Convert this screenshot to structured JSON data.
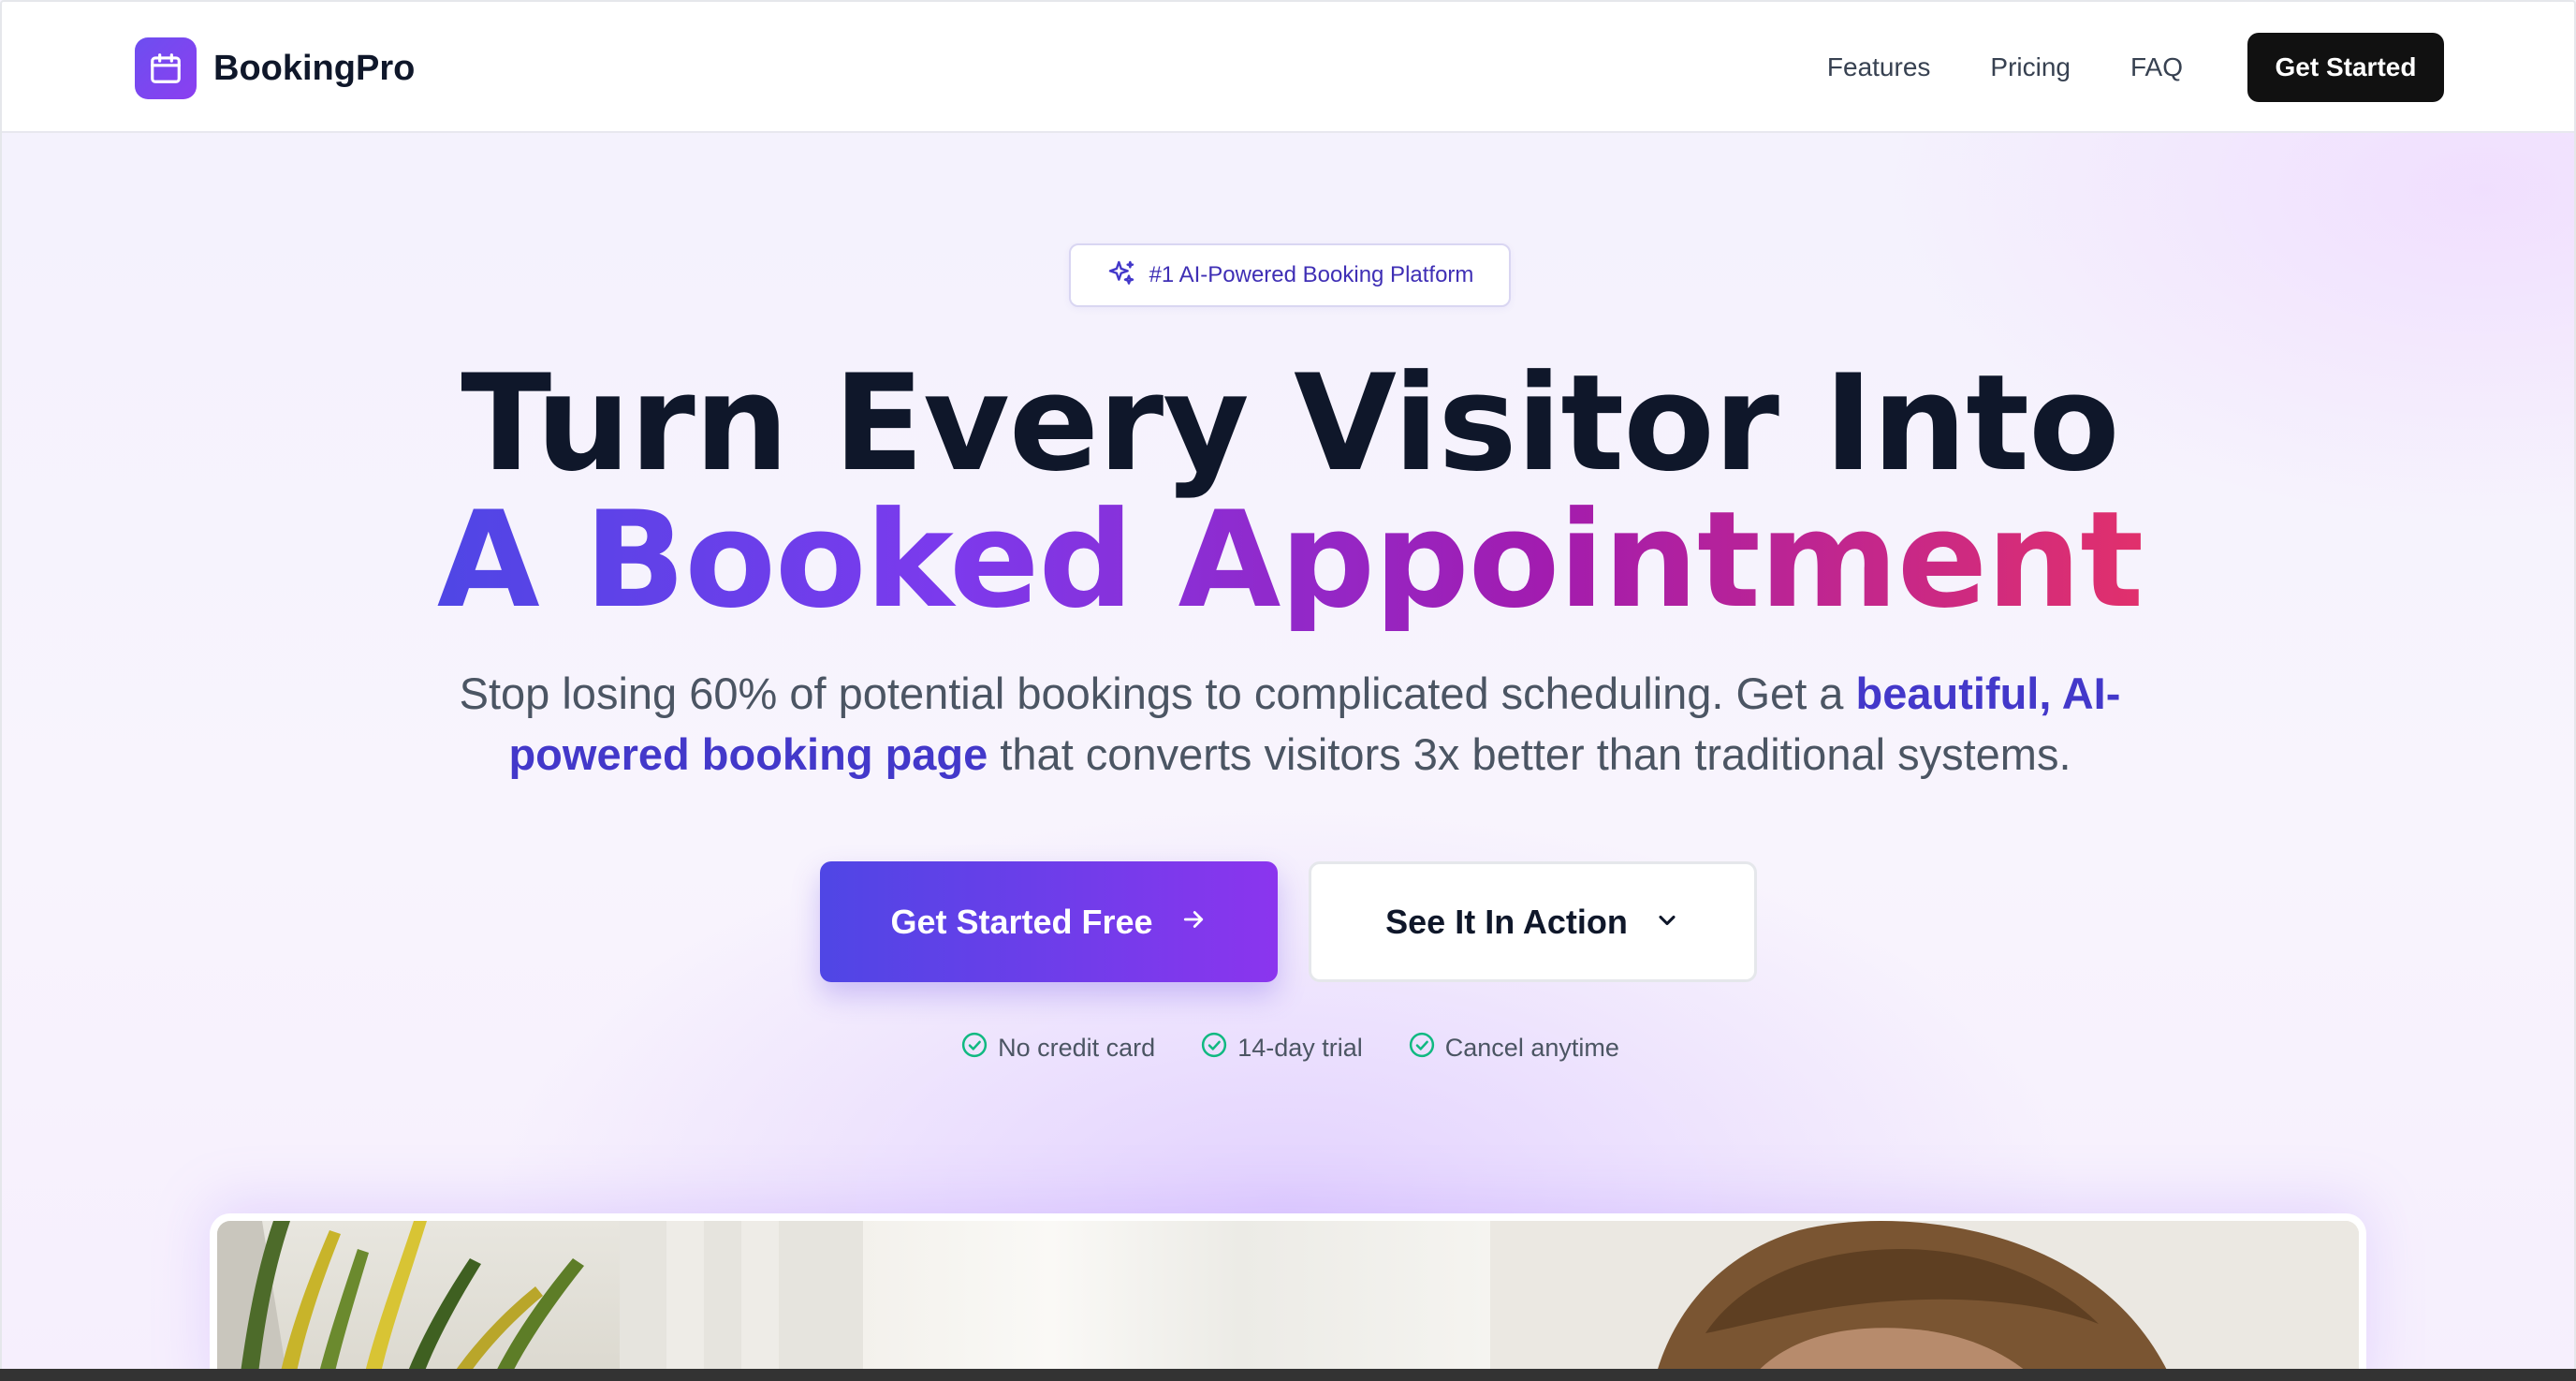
{
  "nav": {
    "brand_name": "BookingPro",
    "links": [
      "Features",
      "Pricing",
      "FAQ"
    ],
    "cta_label": "Get Started"
  },
  "hero": {
    "badge_text": "#1 AI-Powered Booking Platform",
    "headline_line1": "Turn Every Visitor Into",
    "headline_line2": "A Booked Appointment",
    "subtext_part1": "Stop losing 60% of potential bookings to complicated scheduling. Get a ",
    "subtext_highlight": "beautiful, AI-powered booking page",
    "subtext_part2": " that converts visitors 3x better than traditional systems.",
    "primary_cta": "Get Started Free",
    "secondary_cta": "See It In Action",
    "trust_items": [
      "No credit card",
      "14-day trial",
      "Cancel anytime"
    ]
  },
  "colors": {
    "brand_accent": "#6d4ef0",
    "gradient_start": "#4f46e5",
    "gradient_end": "#e1306c",
    "check_green": "#10b981",
    "nav_cta_bg": "#111111"
  },
  "icons": {
    "logo": "calendar-icon",
    "badge": "sparkles-icon",
    "primary_cta": "arrow-right-icon",
    "secondary_cta": "chevron-down-icon",
    "trust": "check-circle-icon"
  }
}
